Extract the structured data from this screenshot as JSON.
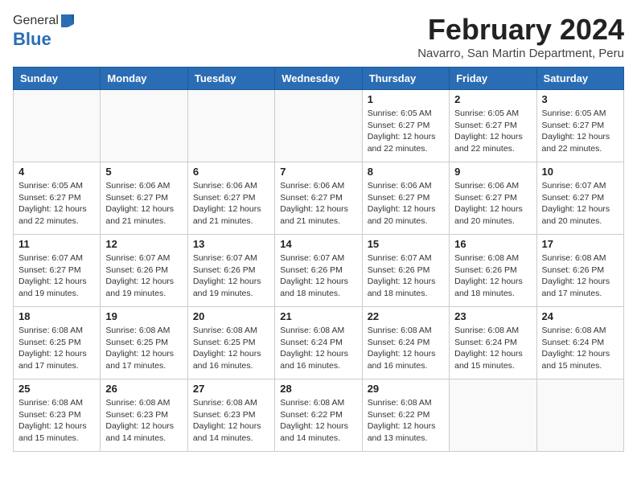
{
  "logo": {
    "general": "General",
    "blue": "Blue"
  },
  "title": "February 2024",
  "subtitle": "Navarro, San Martin Department, Peru",
  "days_of_week": [
    "Sunday",
    "Monday",
    "Tuesday",
    "Wednesday",
    "Thursday",
    "Friday",
    "Saturday"
  ],
  "weeks": [
    [
      {
        "day": "",
        "info": ""
      },
      {
        "day": "",
        "info": ""
      },
      {
        "day": "",
        "info": ""
      },
      {
        "day": "",
        "info": ""
      },
      {
        "day": "1",
        "info": "Sunrise: 6:05 AM\nSunset: 6:27 PM\nDaylight: 12 hours\nand 22 minutes."
      },
      {
        "day": "2",
        "info": "Sunrise: 6:05 AM\nSunset: 6:27 PM\nDaylight: 12 hours\nand 22 minutes."
      },
      {
        "day": "3",
        "info": "Sunrise: 6:05 AM\nSunset: 6:27 PM\nDaylight: 12 hours\nand 22 minutes."
      }
    ],
    [
      {
        "day": "4",
        "info": "Sunrise: 6:05 AM\nSunset: 6:27 PM\nDaylight: 12 hours\nand 22 minutes."
      },
      {
        "day": "5",
        "info": "Sunrise: 6:06 AM\nSunset: 6:27 PM\nDaylight: 12 hours\nand 21 minutes."
      },
      {
        "day": "6",
        "info": "Sunrise: 6:06 AM\nSunset: 6:27 PM\nDaylight: 12 hours\nand 21 minutes."
      },
      {
        "day": "7",
        "info": "Sunrise: 6:06 AM\nSunset: 6:27 PM\nDaylight: 12 hours\nand 21 minutes."
      },
      {
        "day": "8",
        "info": "Sunrise: 6:06 AM\nSunset: 6:27 PM\nDaylight: 12 hours\nand 20 minutes."
      },
      {
        "day": "9",
        "info": "Sunrise: 6:06 AM\nSunset: 6:27 PM\nDaylight: 12 hours\nand 20 minutes."
      },
      {
        "day": "10",
        "info": "Sunrise: 6:07 AM\nSunset: 6:27 PM\nDaylight: 12 hours\nand 20 minutes."
      }
    ],
    [
      {
        "day": "11",
        "info": "Sunrise: 6:07 AM\nSunset: 6:27 PM\nDaylight: 12 hours\nand 19 minutes."
      },
      {
        "day": "12",
        "info": "Sunrise: 6:07 AM\nSunset: 6:26 PM\nDaylight: 12 hours\nand 19 minutes."
      },
      {
        "day": "13",
        "info": "Sunrise: 6:07 AM\nSunset: 6:26 PM\nDaylight: 12 hours\nand 19 minutes."
      },
      {
        "day": "14",
        "info": "Sunrise: 6:07 AM\nSunset: 6:26 PM\nDaylight: 12 hours\nand 18 minutes."
      },
      {
        "day": "15",
        "info": "Sunrise: 6:07 AM\nSunset: 6:26 PM\nDaylight: 12 hours\nand 18 minutes."
      },
      {
        "day": "16",
        "info": "Sunrise: 6:08 AM\nSunset: 6:26 PM\nDaylight: 12 hours\nand 18 minutes."
      },
      {
        "day": "17",
        "info": "Sunrise: 6:08 AM\nSunset: 6:26 PM\nDaylight: 12 hours\nand 17 minutes."
      }
    ],
    [
      {
        "day": "18",
        "info": "Sunrise: 6:08 AM\nSunset: 6:25 PM\nDaylight: 12 hours\nand 17 minutes."
      },
      {
        "day": "19",
        "info": "Sunrise: 6:08 AM\nSunset: 6:25 PM\nDaylight: 12 hours\nand 17 minutes."
      },
      {
        "day": "20",
        "info": "Sunrise: 6:08 AM\nSunset: 6:25 PM\nDaylight: 12 hours\nand 16 minutes."
      },
      {
        "day": "21",
        "info": "Sunrise: 6:08 AM\nSunset: 6:24 PM\nDaylight: 12 hours\nand 16 minutes."
      },
      {
        "day": "22",
        "info": "Sunrise: 6:08 AM\nSunset: 6:24 PM\nDaylight: 12 hours\nand 16 minutes."
      },
      {
        "day": "23",
        "info": "Sunrise: 6:08 AM\nSunset: 6:24 PM\nDaylight: 12 hours\nand 15 minutes."
      },
      {
        "day": "24",
        "info": "Sunrise: 6:08 AM\nSunset: 6:24 PM\nDaylight: 12 hours\nand 15 minutes."
      }
    ],
    [
      {
        "day": "25",
        "info": "Sunrise: 6:08 AM\nSunset: 6:23 PM\nDaylight: 12 hours\nand 15 minutes."
      },
      {
        "day": "26",
        "info": "Sunrise: 6:08 AM\nSunset: 6:23 PM\nDaylight: 12 hours\nand 14 minutes."
      },
      {
        "day": "27",
        "info": "Sunrise: 6:08 AM\nSunset: 6:23 PM\nDaylight: 12 hours\nand 14 minutes."
      },
      {
        "day": "28",
        "info": "Sunrise: 6:08 AM\nSunset: 6:22 PM\nDaylight: 12 hours\nand 14 minutes."
      },
      {
        "day": "29",
        "info": "Sunrise: 6:08 AM\nSunset: 6:22 PM\nDaylight: 12 hours\nand 13 minutes."
      },
      {
        "day": "",
        "info": ""
      },
      {
        "day": "",
        "info": ""
      }
    ]
  ]
}
